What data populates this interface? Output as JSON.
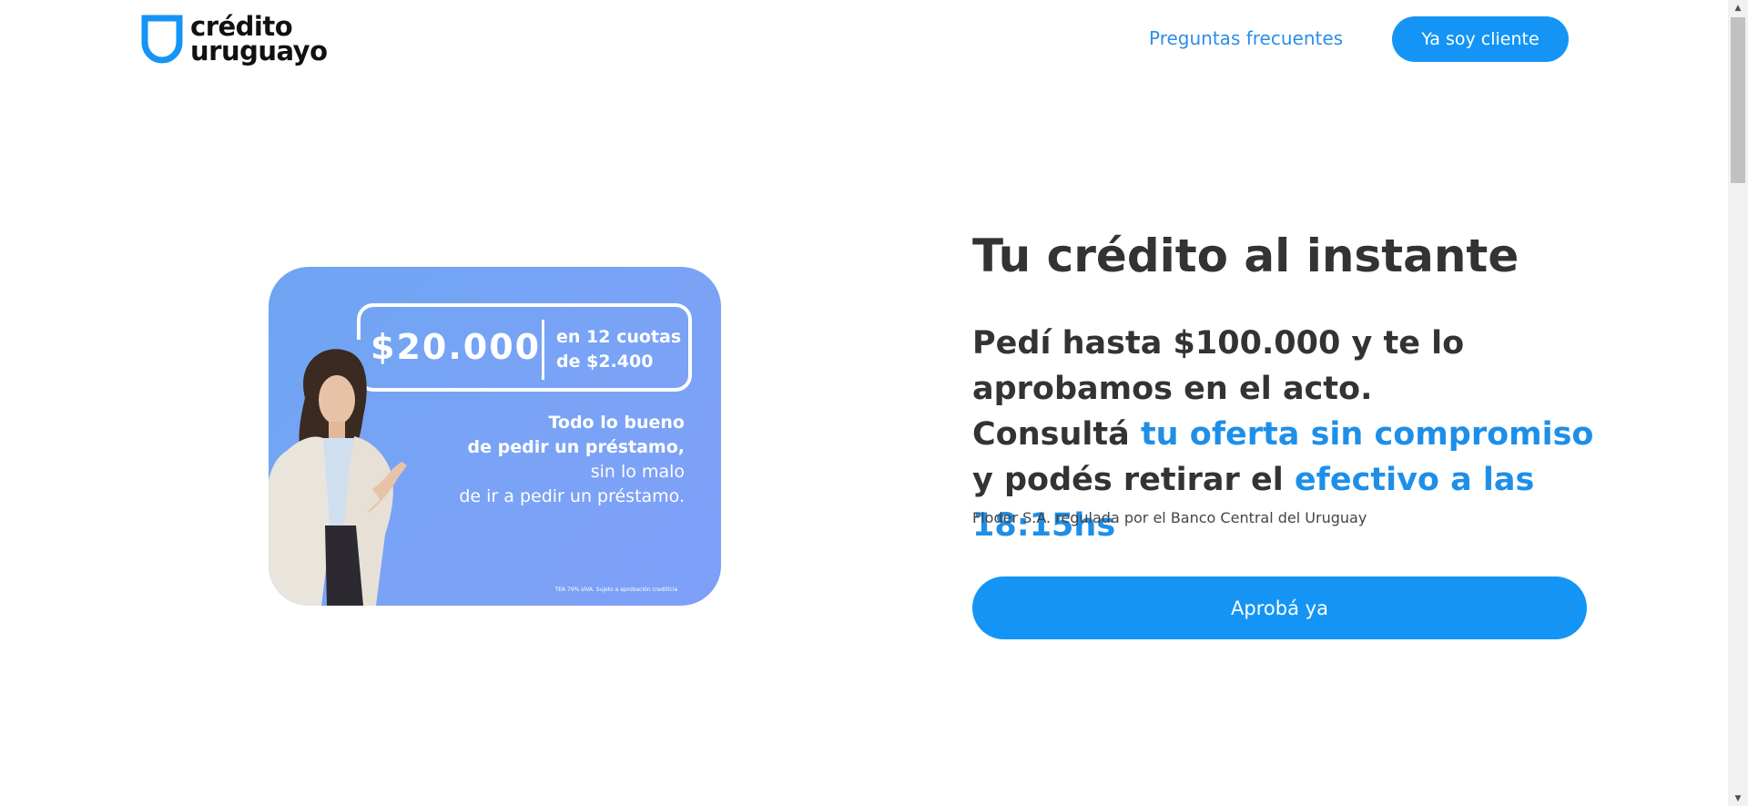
{
  "header": {
    "logo_line1": "crédito",
    "logo_line2": "uruguayo",
    "faq_label": "Preguntas frecuentes",
    "client_button_label": "Ya soy cliente"
  },
  "promo": {
    "amount": "$20.000",
    "terms_line1": "en 12 cuotas",
    "terms_line2": "de $2.400",
    "copy_line1": "Todo lo bueno",
    "copy_line2": "de pedir un préstamo,",
    "copy_line3": "sin lo malo",
    "copy_line4": "de ir a pedir un préstamo.",
    "fine_print": "TEA 79% sIVA. Sujeto a aprobación crediticia"
  },
  "hero": {
    "title": "Tu crédito al instante",
    "text_part1": "Pedí hasta $100.000 y te lo aprobamos en el acto.",
    "text_part2": "Consultá ",
    "text_highlight1": "tu oferta sin compromiso",
    "text_part3": " y podés retirar el ",
    "text_highlight2": "efectivo a las 18:15hs",
    "regulator": "Floder S.A. regulada por el Banco Central del Uruguay",
    "cta_label": "Aprobá ya"
  },
  "colors": {
    "brand_blue": "#1495f5",
    "link_blue": "#2d8ee6",
    "highlight_blue": "#1e8fe8",
    "text_dark": "#333333"
  },
  "icons": {
    "logo": "shield-icon",
    "scroll_up": "triangle-up-icon",
    "scroll_down": "triangle-down-icon"
  }
}
